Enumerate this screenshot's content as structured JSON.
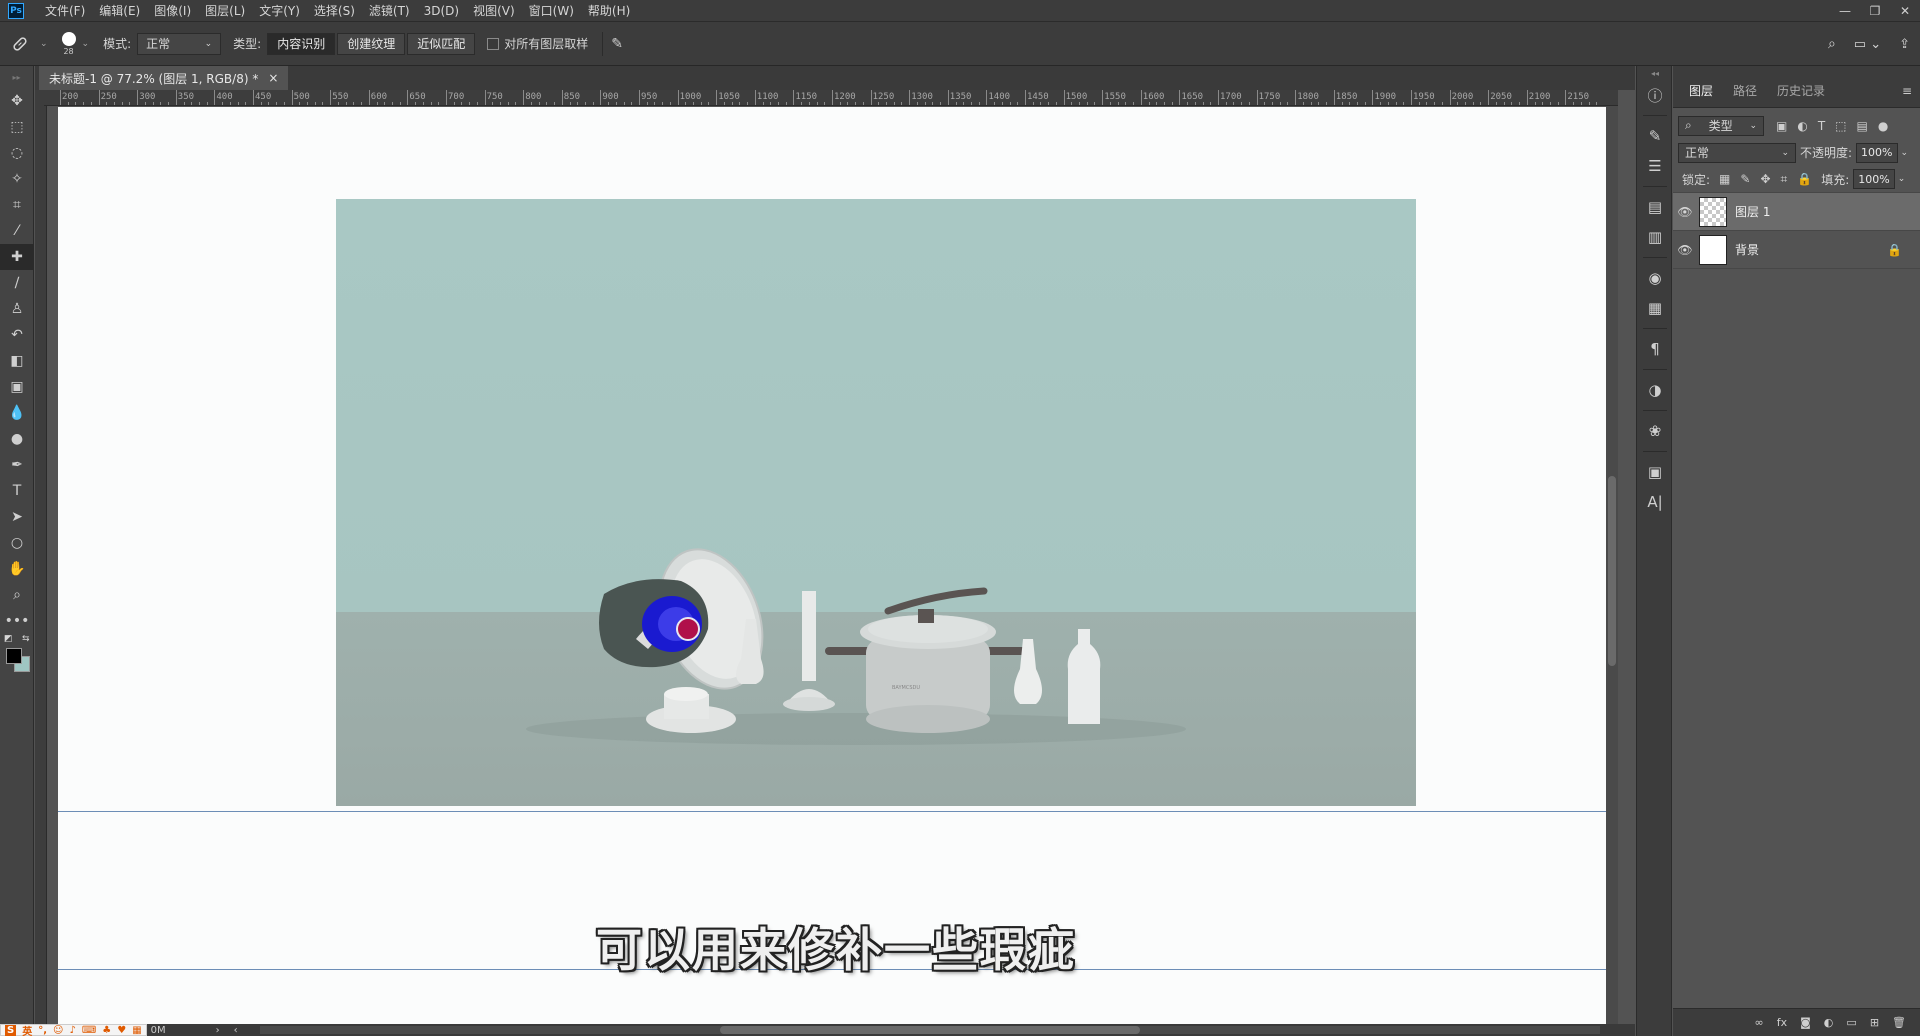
{
  "menubar": {
    "logo": "Ps",
    "items": [
      "文件(F)",
      "编辑(E)",
      "图像(I)",
      "图层(L)",
      "文字(Y)",
      "选择(S)",
      "滤镜(T)",
      "3D(D)",
      "视图(V)",
      "窗口(W)",
      "帮助(H)"
    ],
    "window_controls": [
      "—",
      "❐",
      "✕"
    ]
  },
  "options": {
    "brush_size": "28",
    "mode_label": "模式:",
    "mode_value": "正常",
    "type_label": "类型:",
    "type_buttons": [
      "内容识别",
      "创建纹理",
      "近似匹配"
    ],
    "sample_all_label": "对所有图层取样"
  },
  "document": {
    "tab_title": "未标题-1 @ 77.2% (图层 1, RGB/8) *",
    "tab_close": "×",
    "ruler_numbers": [
      "200",
      "250",
      "300",
      "350",
      "400",
      "450",
      "500",
      "550",
      "600",
      "650",
      "700",
      "750",
      "800",
      "850",
      "900",
      "950",
      "1000",
      "1050",
      "1100",
      "1150",
      "1200",
      "1250",
      "1300",
      "1350",
      "1400",
      "1450",
      "1500",
      "1550",
      "1600",
      "1650",
      "1700",
      "1750",
      "1800",
      "1850",
      "1900",
      "1950",
      "2000",
      "2050",
      "2100",
      "2150"
    ],
    "subtitle": "可以用来修补一些瑕疵"
  },
  "status": {
    "ime_label": "英",
    "doc_size": "0M"
  },
  "layers_panel": {
    "tabs": [
      "图层",
      "路径",
      "历史记录"
    ],
    "filter_value": "类型",
    "blend_mode": "正常",
    "opacity_label": "不透明度:",
    "opacity_value": "100%",
    "lock_label": "锁定:",
    "fill_label": "填充:",
    "fill_value": "100%",
    "layers": [
      {
        "name": "图层 1",
        "selected": true,
        "locked": false
      },
      {
        "name": "背景",
        "selected": false,
        "locked": true
      }
    ]
  },
  "colors": {
    "foreground": "#000000",
    "background": "#9fc6c3",
    "guide": "#6c8db6"
  }
}
